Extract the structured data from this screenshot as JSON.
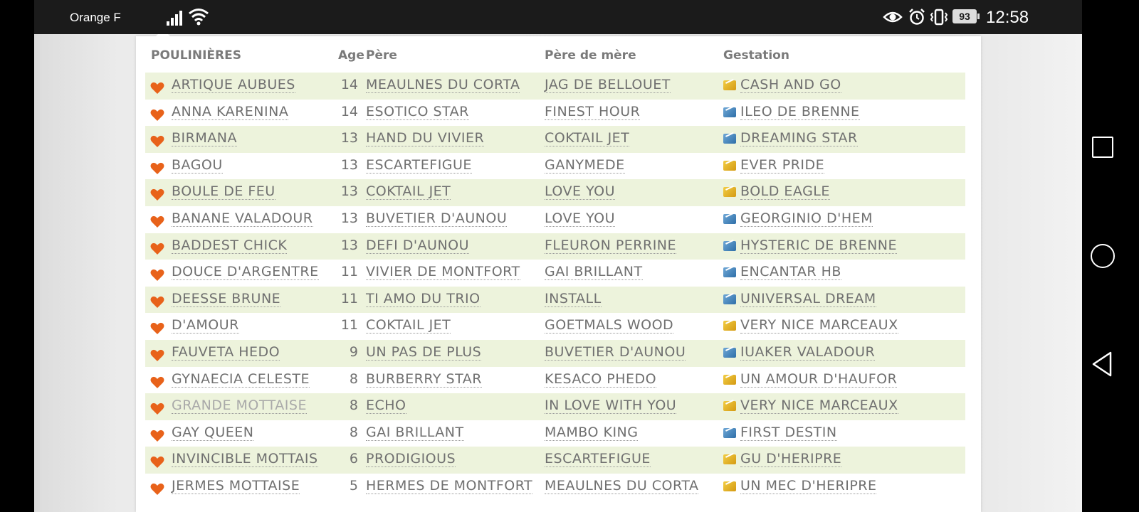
{
  "status_bar": {
    "carrier": "Orange F",
    "battery": "93",
    "time": "12:58"
  },
  "table": {
    "headers": {
      "mares": "POULINIÈRES",
      "age": "Age",
      "sire": "Père",
      "dam_sire": "Père de mère",
      "gestation": "Gestation"
    },
    "rows": [
      {
        "name": "ARTIQUE AUBUES",
        "age": "14",
        "sire": "MEAULNES DU CORTA",
        "dam_sire": "JAG DE BELLOUET",
        "gestation": "CASH AND GO",
        "gest_icon": "yellow"
      },
      {
        "name": "ANNA KARENINA",
        "age": "14",
        "sire": "ESOTICO STAR",
        "dam_sire": "FINEST HOUR",
        "gestation": "ILEO DE BRENNE",
        "gest_icon": "blue"
      },
      {
        "name": "BIRMANA",
        "age": "13",
        "sire": "HAND DU VIVIER",
        "dam_sire": "COKTAIL JET",
        "gestation": "DREAMING STAR",
        "gest_icon": "blue"
      },
      {
        "name": "BAGOU",
        "age": "13",
        "sire": "ESCARTEFIGUE",
        "dam_sire": "GANYMEDE",
        "gestation": "EVER PRIDE",
        "gest_icon": "yellow"
      },
      {
        "name": "BOULE DE FEU",
        "age": "13",
        "sire": "COKTAIL JET",
        "dam_sire": "LOVE YOU",
        "gestation": "BOLD EAGLE",
        "gest_icon": "yellow"
      },
      {
        "name": "BANANE VALADOUR",
        "age": "13",
        "sire": "BUVETIER D'AUNOU",
        "dam_sire": "LOVE YOU",
        "gestation": "GEORGINIO D'HEM",
        "gest_icon": "blue"
      },
      {
        "name": "BADDEST CHICK",
        "age": "13",
        "sire": "DEFI D'AUNOU",
        "dam_sire": "FLEURON PERRINE",
        "gestation": "HYSTERIC DE BRENNE",
        "gest_icon": "blue"
      },
      {
        "name": "DOUCE D'ARGENTRE",
        "age": "11",
        "sire": "VIVIER DE MONTFORT",
        "dam_sire": "GAI BRILLANT",
        "gestation": "ENCANTAR HB",
        "gest_icon": "blue"
      },
      {
        "name": "DEESSE BRUNE",
        "age": "11",
        "sire": "TI AMO DU TRIO",
        "dam_sire": "INSTALL",
        "gestation": "UNIVERSAL DREAM",
        "gest_icon": "blue"
      },
      {
        "name": "D'AMOUR",
        "age": "11",
        "sire": "COKTAIL JET",
        "dam_sire": "GOETMALS WOOD",
        "gestation": "VERY NICE MARCEAUX",
        "gest_icon": "yellow"
      },
      {
        "name": "FAUVETA HEDO",
        "age": "9",
        "sire": "UN PAS DE PLUS",
        "dam_sire": "BUVETIER D'AUNOU",
        "gestation": "IUAKER VALADOUR",
        "gest_icon": "blue"
      },
      {
        "name": "GYNAECIA CELESTE",
        "age": "8",
        "sire": "BURBERRY STAR",
        "dam_sire": "KESACO PHEDO",
        "gestation": "UN AMOUR D'HAUFOR",
        "gest_icon": "yellow"
      },
      {
        "name": "GRANDE MOTTAISE",
        "age": "8",
        "sire": "ECHO",
        "dam_sire": "IN LOVE WITH YOU",
        "gestation": "VERY NICE MARCEAUX",
        "gest_icon": "yellow",
        "dim": true
      },
      {
        "name": "GAY QUEEN",
        "age": "8",
        "sire": "GAI BRILLANT",
        "dam_sire": "MAMBO KING",
        "gestation": "FIRST DESTIN",
        "gest_icon": "blue"
      },
      {
        "name": "INVINCIBLE MOTTAIS",
        "age": "6",
        "sire": "PRODIGIOUS",
        "dam_sire": "ESCARTEFIGUE",
        "gestation": "GU D'HERIPRE",
        "gest_icon": "yellow"
      },
      {
        "name": "JERMES MOTTAISE",
        "age": "5",
        "sire": "HERMES DE MONTFORT",
        "dam_sire": "MEAULNES DU CORTA",
        "gestation": "UN MEC D'HERIPRE",
        "gest_icon": "yellow"
      }
    ]
  },
  "colors": {
    "heart": "#e8621a",
    "row_alt": "#edf3dc",
    "gest_yellow": "#e5b62b",
    "gest_blue": "#3f83bd"
  }
}
